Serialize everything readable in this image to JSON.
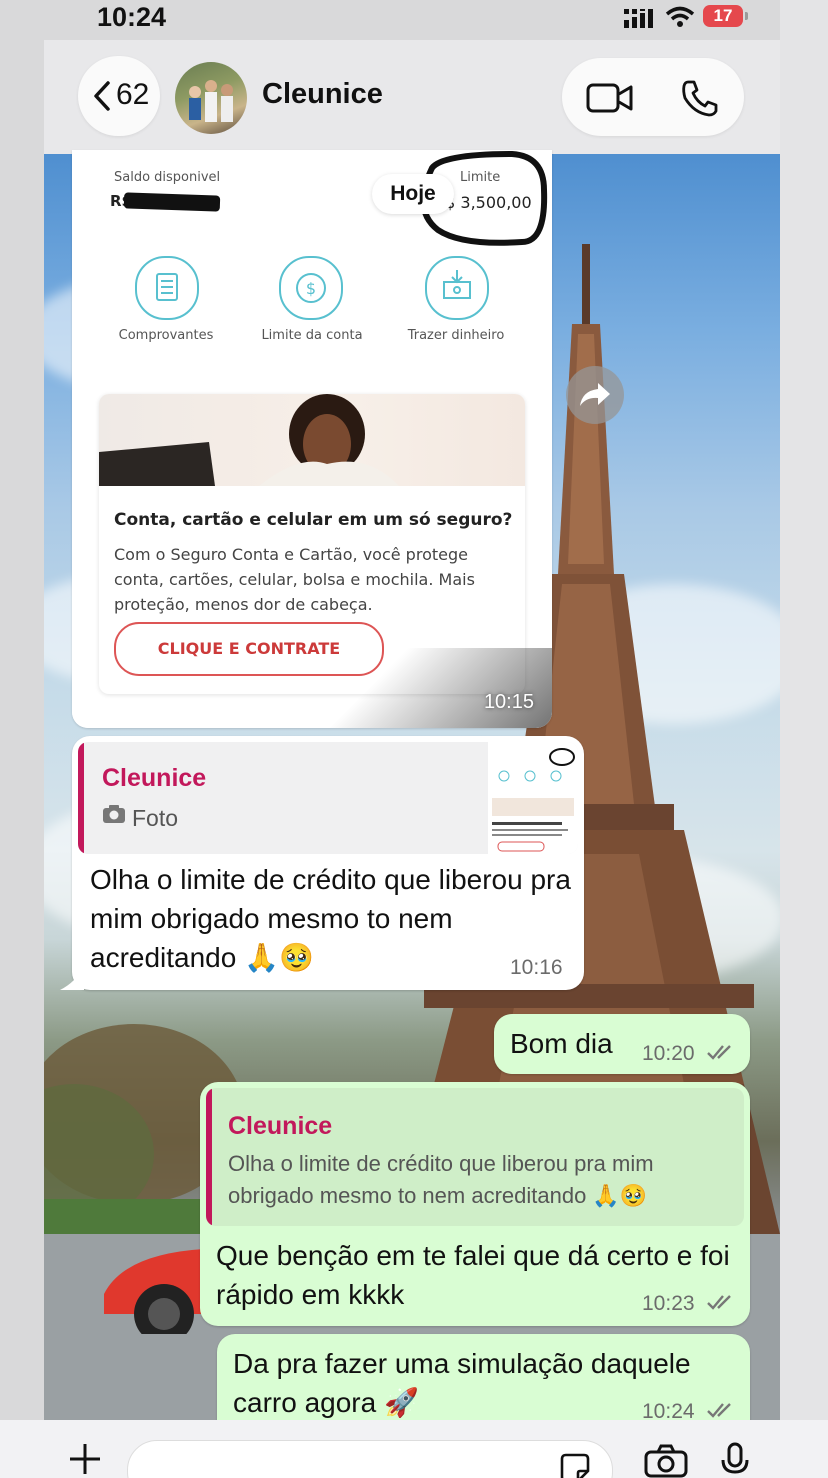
{
  "status_bar": {
    "time": "10:24",
    "battery": "17"
  },
  "header": {
    "back_count": "62",
    "contact_name": "Cleunice"
  },
  "image_message": {
    "saldo_label": "Saldo disponivel",
    "saldo_prefix": "R$",
    "hoje": "Hoje",
    "limite_label": "Limite",
    "limite_value": "R$ 3,500,00",
    "actions": [
      "Comprovantes",
      "Limite da conta",
      "Trazer dinheiro"
    ],
    "promo_title": "Conta, cartão e celular em um só seguro?",
    "promo_text": "Com o Seguro Conta e Cartão, você protege conta, cartões, celular, bolsa e mochila. Mais proteção, menos dor de cabeça.",
    "promo_button": "CLIQUE E CONTRATE",
    "time": "10:15"
  },
  "messages": [
    {
      "direction": "in",
      "quote_name": "Cleunice",
      "quote_text": "Foto",
      "text": "Olha o limite de crédito que liberou pra mim obrigado mesmo to nem acreditando 🙏🥹",
      "time": "10:16"
    },
    {
      "direction": "out",
      "text": "Bom dia",
      "time": "10:20"
    },
    {
      "direction": "out",
      "quote_name": "Cleunice",
      "quote_text": "Olha o limite de crédito que liberou pra mim obrigado mesmo to nem acreditando 🙏🥹",
      "text": "Que benção em te falei que dá certo e foi rápido em kkkk",
      "time": "10:23"
    },
    {
      "direction": "out",
      "text": "Da pra fazer uma simulação daquele carro agora 🚀",
      "time": "10:24"
    }
  ],
  "colors": {
    "outgoing": "#d9fdd3",
    "incoming": "#ffffff",
    "quote_accent": "#c2185b",
    "battery": "#e5484d"
  },
  "icons": [
    "back-chevron-icon",
    "video-call-icon",
    "phone-icon",
    "forward-icon",
    "camera-icon",
    "plus-icon",
    "sticker-icon",
    "mic-icon"
  ]
}
